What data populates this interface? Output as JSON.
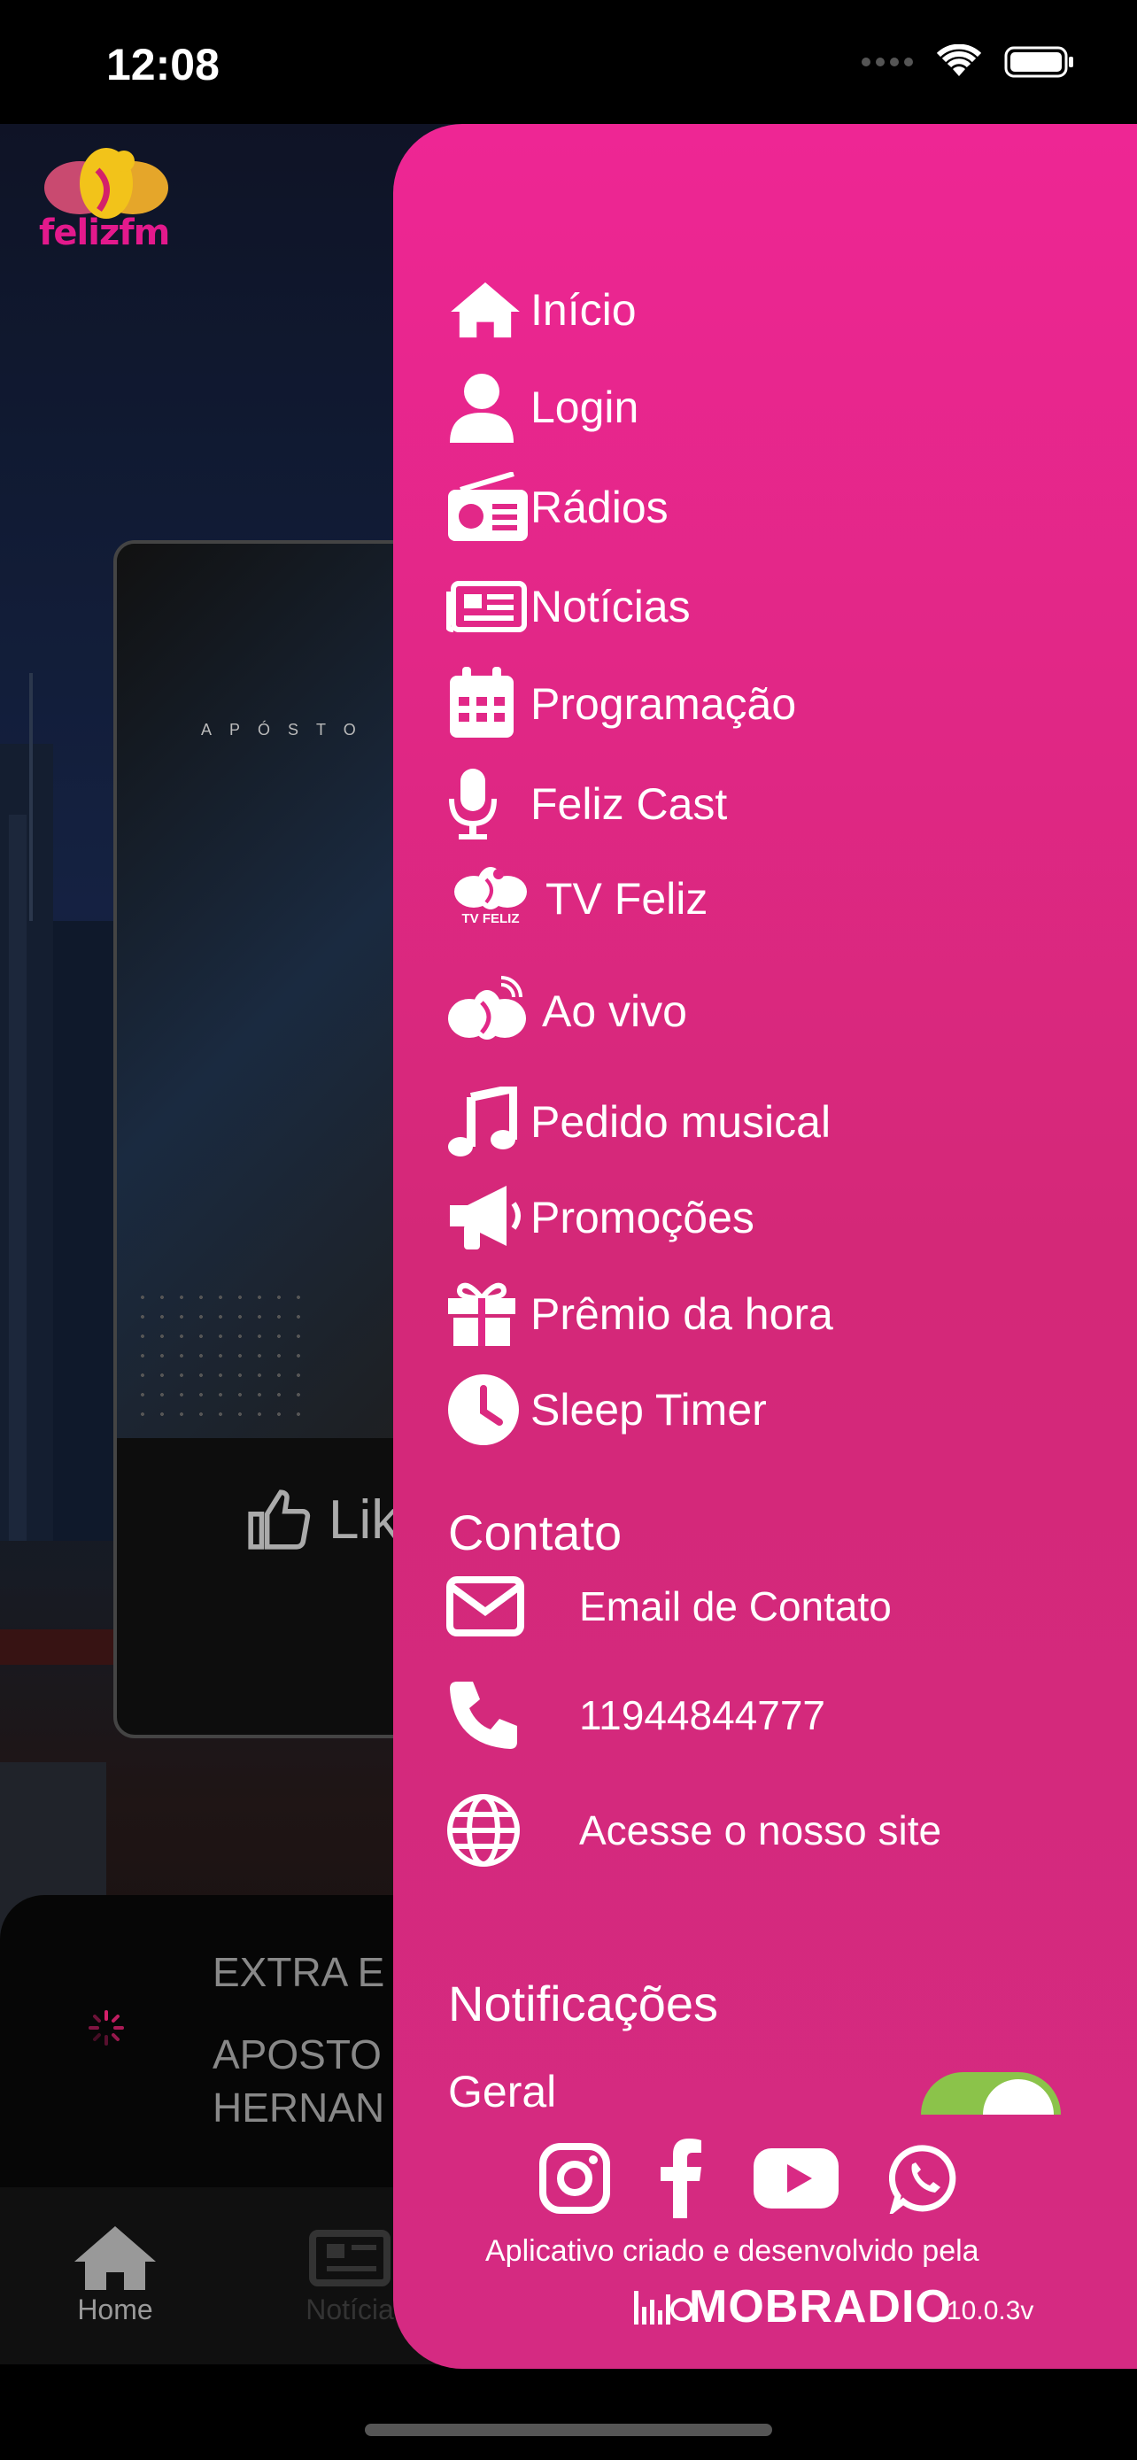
{
  "status": {
    "time": "12:08"
  },
  "logo": {
    "text": "felizfm"
  },
  "card": {
    "letters": "APÓSTO",
    "like_label": "Lik"
  },
  "player": {
    "label": "EXTRA E",
    "title": "APOSTO HERNAN"
  },
  "tabs": [
    {
      "label": "Home"
    },
    {
      "label": "Notícia"
    }
  ],
  "menu": [
    {
      "label": "Início",
      "icon": "home-icon"
    },
    {
      "label": "Login",
      "icon": "user-icon"
    },
    {
      "label": "Rádios",
      "icon": "radio-icon"
    },
    {
      "label": "Notícias",
      "icon": "newspaper-icon"
    },
    {
      "label": "Programação",
      "icon": "calendar-icon"
    },
    {
      "label": "Feliz Cast",
      "icon": "microphone-icon"
    },
    {
      "label": "TV Feliz",
      "icon": "tv-feliz-icon",
      "icon_text": "TV FELIZ"
    },
    {
      "label": "Ao vivo",
      "icon": "live-icon"
    },
    {
      "label": "Pedido musical",
      "icon": "music-icon"
    },
    {
      "label": "Promoções",
      "icon": "megaphone-icon"
    },
    {
      "label": "Prêmio da hora",
      "icon": "gift-icon"
    },
    {
      "label": "Sleep Timer",
      "icon": "clock-icon"
    }
  ],
  "contact": {
    "title": "Contato",
    "items": [
      {
        "label": "Email de Contato",
        "icon": "envelope-icon"
      },
      {
        "label": "11944844777",
        "icon": "phone-icon"
      },
      {
        "label": "Acesse o nosso site",
        "icon": "globe-icon"
      }
    ]
  },
  "notifications": {
    "title": "Notificações",
    "general_label": "Geral",
    "general_on": true
  },
  "social": [
    "instagram-icon",
    "facebook-icon",
    "youtube-icon",
    "whatsapp-icon"
  ],
  "footer": {
    "credit": "Aplicativo criado e desenvolvido pela",
    "brand": "MOBRADIO",
    "version": "10.0.3v"
  },
  "colors": {
    "drawer_top": "#ee2694",
    "drawer_bottom": "#d52a82",
    "toggle": "#8bc34a"
  }
}
